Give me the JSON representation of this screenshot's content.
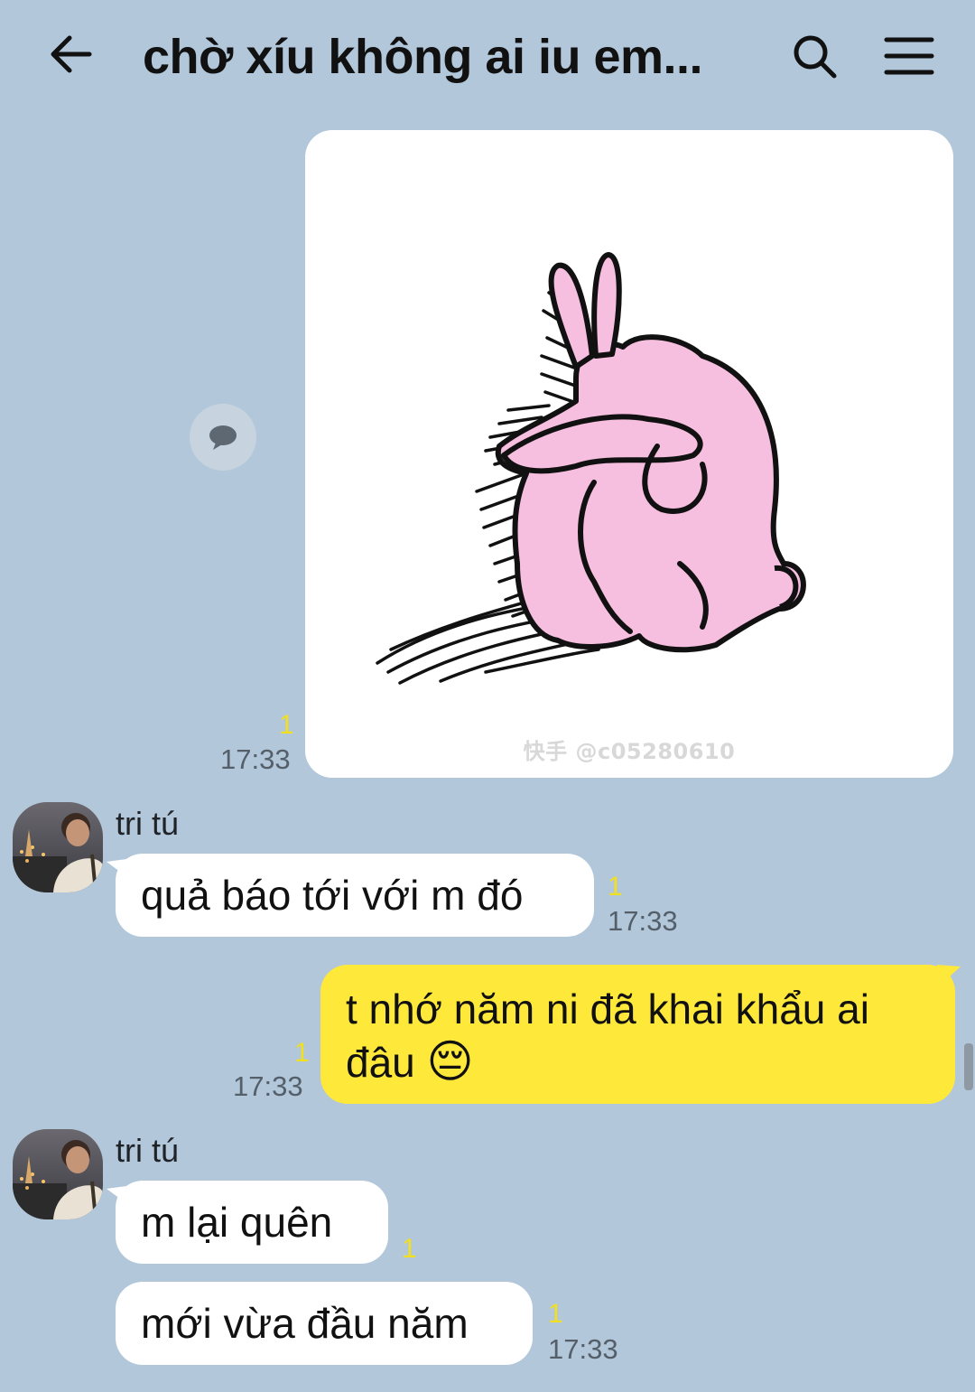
{
  "header": {
    "title": "chờ xíu không ai iu em...",
    "back_icon": "arrow-left-icon",
    "search_icon": "search-icon",
    "menu_icon": "hamburger-menu-icon"
  },
  "messages": [
    {
      "type": "sticker",
      "from": "me",
      "sticker": "pink-rabbit-sitting-sad",
      "watermark": "快手 @c05280610",
      "unread": "1",
      "time": "17:33"
    },
    {
      "type": "text",
      "from": "tri tú",
      "text": "quả báo tới với m đó",
      "unread": "1",
      "time": "17:33"
    },
    {
      "type": "text",
      "from": "me",
      "text": "t nhớ năm ni đã khai khẩu ai đâu",
      "emoji": "😔",
      "unread": "1",
      "time": "17:33"
    },
    {
      "type": "text",
      "from": "tri tú",
      "text": "m lại quên",
      "unread": "1"
    },
    {
      "type": "text",
      "from": "tri tú",
      "text": "mới vừa đầu năm",
      "unread": "1",
      "time": "17:33"
    }
  ],
  "colors": {
    "background": "#b2c7da",
    "my_bubble": "#fee83a",
    "their_bubble": "#ffffff",
    "unread_count": "#f2df1f"
  }
}
